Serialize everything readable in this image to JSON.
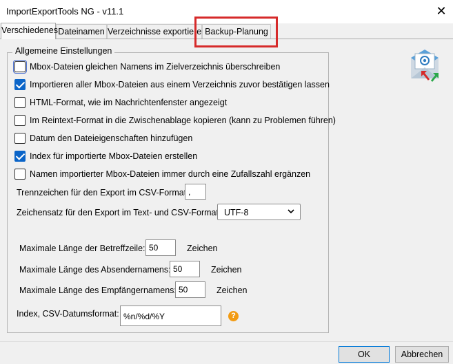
{
  "window": {
    "title": "ImportExportTools NG - v11.1",
    "close_symbol": "✕"
  },
  "tabs": [
    {
      "label": "Verschiedenes",
      "active": true
    },
    {
      "label": "Dateinamen",
      "active": false
    },
    {
      "label": "Verzeichnisse exportieren",
      "active": false
    },
    {
      "label": "Backup-Planung",
      "active": false
    }
  ],
  "group": {
    "title": "Allgemeine Einstellungen"
  },
  "checkboxes": [
    {
      "label": "Mbox-Dateien gleichen Namens im Zielverzeichnis überschreiben",
      "checked": false
    },
    {
      "label": "Importieren aller Mbox-Dateien aus einem Verzeichnis zuvor bestätigen lassen",
      "checked": true
    },
    {
      "label": "HTML-Format, wie im Nachrichtenfenster angezeigt",
      "checked": false
    },
    {
      "label": "Im Reintext-Format in die Zwischenablage kopieren (kann zu Problemen führen)",
      "checked": false
    },
    {
      "label": "Datum den Dateieigenschaften hinzufügen",
      "checked": false
    },
    {
      "label": "Index für importierte Mbox-Dateien erstellen",
      "checked": true
    },
    {
      "label": "Namen importierter Mbox-Dateien immer durch eine Zufallszahl ergänzen",
      "checked": false
    }
  ],
  "csv_separator": {
    "label": "Trennzeichen für den Export im CSV-Format:",
    "value": ","
  },
  "charset": {
    "label": "Zeichensatz für den Export im Text- und CSV-Format:",
    "value": "UTF-8"
  },
  "limits": {
    "subject": {
      "label": "Maximale Länge der Betreffzeile:",
      "value": "50",
      "unit": "Zeichen"
    },
    "sender": {
      "label": "Maximale Länge des Absendernamens:",
      "value": "50",
      "unit": "Zeichen"
    },
    "recipient": {
      "label": "Maximale Länge des Empfängernamens:",
      "value": "50",
      "unit": "Zeichen"
    }
  },
  "date_format": {
    "label": "Index, CSV-Datumsformat:",
    "value": "%n/%d/%Y",
    "help_symbol": "?"
  },
  "buttons": {
    "ok": "OK",
    "cancel": "Abbrechen"
  },
  "colors": {
    "accent": "#0a64c8",
    "highlight": "#d62a2a",
    "help": "#f29b12"
  }
}
